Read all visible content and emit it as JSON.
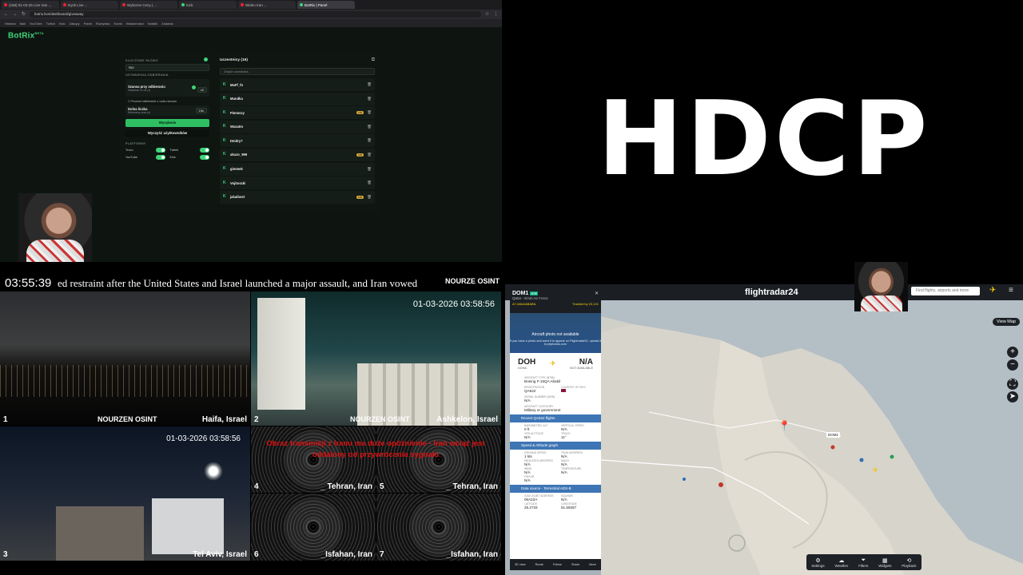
{
  "browser": {
    "tabs": [
      "(168) 01-03-26 Live Iran ...",
      "Dysk Live ...",
      "Wyborne Ceny | ...",
      "Kick",
      "Wideo Iran ...",
      "BotRix | Panel"
    ],
    "url": "botrix.live/dashboard/giveaway",
    "bookmarks": [
      "Historia",
      "Mail",
      "YouTube",
      "Twitch",
      "Kick",
      "Zakupy",
      "Panel",
      "Rozrywka",
      "Konto",
      "Wiadomości",
      "Notatki",
      "Zadania"
    ],
    "app_logo": "BotRix",
    "app_logo_sup": "BETA"
  },
  "giveaway": {
    "keyword_label": "KLUCZOWE SŁOWO",
    "keyword_value": "!wo",
    "settings_label": "USTAWIENIA ODBIERANIA",
    "opt1_title": "Szansa przy odbieraniu",
    "opt1_sub": "Zwiększa co do (x)",
    "opt1_value": "x2",
    "checkbox_label": "Pozwól odbieranie z czatu kanału",
    "opt2_title": "Dolna liczba",
    "opt2_sub": "Minimalny czas (s)",
    "opt2_value": "15s",
    "start_button": "Wysyłanie",
    "clear_button": "Wyczyść użytkowników",
    "platforms_label": "PLATFORMY",
    "platforms": [
      "Trovo",
      "Twitch",
      "YouTube",
      "Kick"
    ]
  },
  "users": {
    "title": "Uczestnicy (16)",
    "search_placeholder": "Znajdź uczestnika...",
    "list": [
      {
        "name": "MaFf_fn",
        "badge": ""
      },
      {
        "name": "Mundka",
        "badge": ""
      },
      {
        "name": "Pierwszy",
        "badge": "sub"
      },
      {
        "name": "Wuzatm",
        "badge": ""
      },
      {
        "name": "Dmitry7",
        "badge": ""
      },
      {
        "name": "akuzo_999",
        "badge": "sub"
      },
      {
        "name": "gimmek",
        "badge": ""
      },
      {
        "name": "Vojitoszki",
        "badge": ""
      },
      {
        "name": "jakaibost",
        "badge": "sub"
      }
    ]
  },
  "hdcp": {
    "text": "HDCP"
  },
  "news": {
    "clock": "03:55:39",
    "ticker": "ed restraint after the United States and Israel launched a major assault, and Iran vowed",
    "ticker_logo": "NOURZE OSINT",
    "watermark": "NOURZEN OSINT",
    "timestamp1": "01-03-2026  03:58:56",
    "timestamp2": "01-03-2026 03:58:56",
    "red_message": "Obraz transmisji z Iranu ma duże opóźnienie - Iran wciąż jest oddalony od przywrócenia sygnału",
    "cams": [
      {
        "num": "1",
        "loc": "Haifa, Israel"
      },
      {
        "num": "2",
        "loc": "Ashkelon, Israel"
      },
      {
        "num": "3",
        "loc": "Tel Aviv, Israel"
      },
      {
        "num": "4",
        "loc": "_ Tehran, Iran"
      },
      {
        "num": "5",
        "loc": "_ Tehran, Iran"
      },
      {
        "num": "6",
        "loc": "_Isfahan, Iran"
      },
      {
        "num": "7",
        "loc": "_Isfahan, Iran"
      }
    ]
  },
  "flightradar": {
    "brand": "flightradar24",
    "search_placeholder": "Find flights, airports and more",
    "view_label": "View  Map",
    "callout": "DOM1",
    "panel": {
      "callsign": "DOM1",
      "tag": "STE",
      "airline": "Qatar - Emiri Air Force",
      "sub_left": "A7-MAA/ABABIL",
      "sub_right": "Tracked by 23,121",
      "photo_title": "Aircraft photo not available",
      "photo_sub": "If you have a photo and want it to appear on Flightradar24, upload it to jetphotos.com",
      "origin": "DOH",
      "origin_sub": "DOHA",
      "dest": "N/A",
      "dest_sub": "NOT AVAILABLE",
      "aircraft_type_label": "AIRCRAFT TYPE (B788)",
      "aircraft_type": "Boeing F-15QA Ababil",
      "reg_label": "REGISTRATION",
      "reg": "QA522",
      "country_label": "COUNTRY OF REG.",
      "serial_label": "SERIAL NUMBER (MSN)",
      "serial": "N/A",
      "category_label": "AIRCRAFT CATEGORY",
      "category": "Military or government",
      "recent_header": "Recent QA522 flights",
      "baro_label": "BAROMETRIC ALT.",
      "baro": "0 ft",
      "vspeed_label": "VERTICAL SPEED",
      "vspeed": "N/A",
      "gps_label": "GPS ALTITUDE",
      "gps": "N/A",
      "track_label": "TRACK",
      "track": "11°",
      "speed_header": "Speed & Altitude graph",
      "gs_label": "GROUND SPEED",
      "gs": "1 kts",
      "tas_label": "TRUE AIRSPEED",
      "tas": "N/A",
      "ias_label": "INDICATED AIRSPEED",
      "ias": "N/A",
      "mach_label": "MACH",
      "mach": "N/A",
      "wind_label": "WIND",
      "wind": "N/A",
      "temp_label": "TEMPERATURE",
      "temp": "N/A",
      "fir_label": "FIR/UIR",
      "fir": "N/A",
      "source_header": "Data source - Terrestrial ADS-B",
      "icao_label": "ICAO 24-BIT ADDRESS",
      "icao": "06A22A",
      "squawk_label": "SQUAWK",
      "squawk": "N/A",
      "lat_label": "LATITUDE",
      "lat": "25.2733",
      "lon_label": "LONGITUDE",
      "lon": "51.59267",
      "footer": [
        "3D view",
        "Route",
        "Follow",
        "Share",
        "More"
      ]
    },
    "bottombar": [
      "Settings",
      "Weather",
      "Filters",
      "Widgets",
      "Playback"
    ]
  }
}
